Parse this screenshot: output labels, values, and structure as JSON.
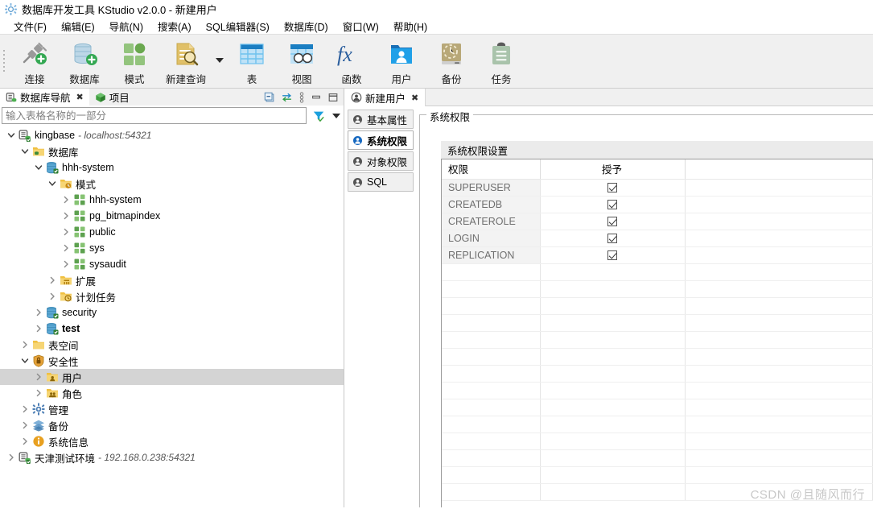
{
  "window": {
    "title": "数据库开发工具 KStudio v2.0.0 - 新建用户",
    "app_icon": "gear-app-icon"
  },
  "menubar": {
    "items": [
      {
        "label": "文件(F)"
      },
      {
        "label": "编辑(E)"
      },
      {
        "label": "导航(N)"
      },
      {
        "label": "搜索(A)"
      },
      {
        "label": "SQL编辑器(S)"
      },
      {
        "label": "数据库(D)"
      },
      {
        "label": "窗口(W)"
      },
      {
        "label": "帮助(H)"
      }
    ]
  },
  "toolbar": {
    "buttons": [
      {
        "label": "连接",
        "icon": "plug-connect-icon"
      },
      {
        "label": "数据库",
        "icon": "database-add-icon"
      },
      {
        "label": "模式",
        "icon": "schema-squares-icon"
      },
      {
        "label": "新建查询",
        "icon": "new-query-icon"
      },
      {
        "label": "表",
        "icon": "table-icon"
      },
      {
        "label": "视图",
        "icon": "view-icon"
      },
      {
        "label": "函数",
        "icon": "function-fx-icon"
      },
      {
        "label": "用户",
        "icon": "user-folder-icon"
      },
      {
        "label": "备份",
        "icon": "backup-clock-icon"
      },
      {
        "label": "任务",
        "icon": "task-clipboard-icon"
      }
    ]
  },
  "left_panel": {
    "tabs": [
      {
        "label": "数据库导航",
        "icon": "db-nav-icon",
        "active": true,
        "closable": true
      },
      {
        "label": "项目",
        "icon": "project-cube-icon",
        "active": false,
        "closable": false
      }
    ],
    "tools": [
      {
        "name": "collapse-all-icon"
      },
      {
        "name": "link-sync-icon"
      },
      {
        "name": "view-menu-icon"
      },
      {
        "name": "minimize-icon"
      },
      {
        "name": "maximize-icon"
      }
    ],
    "filter": {
      "placeholder": "输入表格名称的一部分",
      "value": "",
      "filter_icon": "filter-funnel-icon",
      "dropdown_icon": "chevron-down-icon"
    },
    "tree": [
      {
        "indent": 0,
        "arrow": "down",
        "icon": "connection-icon",
        "label": "kingbase",
        "sub": "- localhost:54321",
        "bold": false,
        "selected": false
      },
      {
        "indent": 1,
        "arrow": "down",
        "icon": "folder-db-icon",
        "label": "数据库",
        "sub": "",
        "bold": false,
        "selected": false
      },
      {
        "indent": 2,
        "arrow": "down",
        "icon": "database-icon",
        "label": "hhh-system",
        "sub": "",
        "bold": false,
        "selected": false
      },
      {
        "indent": 3,
        "arrow": "down",
        "icon": "folder-schema-icon",
        "label": "模式",
        "sub": "",
        "bold": false,
        "selected": false
      },
      {
        "indent": 4,
        "arrow": "right",
        "icon": "schema-icon",
        "label": "hhh-system",
        "sub": "",
        "bold": false,
        "selected": false
      },
      {
        "indent": 4,
        "arrow": "right",
        "icon": "schema-icon",
        "label": "pg_bitmapindex",
        "sub": "",
        "bold": false,
        "selected": false
      },
      {
        "indent": 4,
        "arrow": "right",
        "icon": "schema-icon",
        "label": "public",
        "sub": "",
        "bold": false,
        "selected": false
      },
      {
        "indent": 4,
        "arrow": "right",
        "icon": "schema-icon",
        "label": "sys",
        "sub": "",
        "bold": false,
        "selected": false
      },
      {
        "indent": 4,
        "arrow": "right",
        "icon": "schema-icon",
        "label": "sysaudit",
        "sub": "",
        "bold": false,
        "selected": false
      },
      {
        "indent": 3,
        "arrow": "right",
        "icon": "folder-ext-icon",
        "label": "扩展",
        "sub": "",
        "bold": false,
        "selected": false
      },
      {
        "indent": 3,
        "arrow": "right",
        "icon": "folder-job-icon",
        "label": "计划任务",
        "sub": "",
        "bold": false,
        "selected": false
      },
      {
        "indent": 2,
        "arrow": "right",
        "icon": "database-icon",
        "label": "security",
        "sub": "",
        "bold": false,
        "selected": false
      },
      {
        "indent": 2,
        "arrow": "right",
        "icon": "database-icon",
        "label": "test",
        "sub": "",
        "bold": true,
        "selected": false
      },
      {
        "indent": 1,
        "arrow": "right",
        "icon": "folder-icon",
        "label": "表空间",
        "sub": "",
        "bold": false,
        "selected": false
      },
      {
        "indent": 1,
        "arrow": "down",
        "icon": "security-icon",
        "label": "安全性",
        "sub": "",
        "bold": false,
        "selected": false
      },
      {
        "indent": 2,
        "arrow": "right",
        "icon": "folder-user-icon",
        "label": "用户",
        "sub": "",
        "bold": false,
        "selected": true
      },
      {
        "indent": 2,
        "arrow": "right",
        "icon": "folder-role-icon",
        "label": "角色",
        "sub": "",
        "bold": false,
        "selected": false
      },
      {
        "indent": 1,
        "arrow": "right",
        "icon": "admin-gear-icon",
        "label": "管理",
        "sub": "",
        "bold": false,
        "selected": false
      },
      {
        "indent": 1,
        "arrow": "right",
        "icon": "backup-layers-icon",
        "label": "备份",
        "sub": "",
        "bold": false,
        "selected": false
      },
      {
        "indent": 1,
        "arrow": "right",
        "icon": "info-icon",
        "label": "系统信息",
        "sub": "",
        "bold": false,
        "selected": false
      },
      {
        "indent": 0,
        "arrow": "right",
        "icon": "connection-icon",
        "label": "天津测试环境",
        "sub": "- 192.168.0.238:54321",
        "bold": false,
        "selected": false
      }
    ]
  },
  "editor": {
    "tabs": [
      {
        "label": "新建用户",
        "icon": "user-circle-icon",
        "active": true,
        "closable": true
      }
    ],
    "side_tabs": [
      {
        "label": "基本属性",
        "icon": "user-circle-icon",
        "active": false
      },
      {
        "label": "系统权限",
        "icon": "user-circle-icon",
        "active": true
      },
      {
        "label": "对象权限",
        "icon": "user-circle-icon",
        "active": false
      },
      {
        "label": "SQL",
        "icon": "user-circle-icon",
        "active": false
      }
    ],
    "group_title": "系统权限",
    "section_header": "系统权限设置",
    "table": {
      "columns": [
        "权限",
        "授予",
        ""
      ],
      "rows": [
        {
          "name": "SUPERUSER",
          "granted": true
        },
        {
          "name": "CREATEDB",
          "granted": true
        },
        {
          "name": "CREATEROLE",
          "granted": true
        },
        {
          "name": "LOGIN",
          "granted": true
        },
        {
          "name": "REPLICATION",
          "granted": true
        }
      ],
      "empty_rows": 14
    }
  },
  "watermark": "CSDN @且随风而行",
  "colors": {
    "accent_blue": "#0b77c2",
    "green": "#4caf50",
    "folder_yellow": "#ecb52b",
    "selected_row": "#d4d4d4"
  }
}
